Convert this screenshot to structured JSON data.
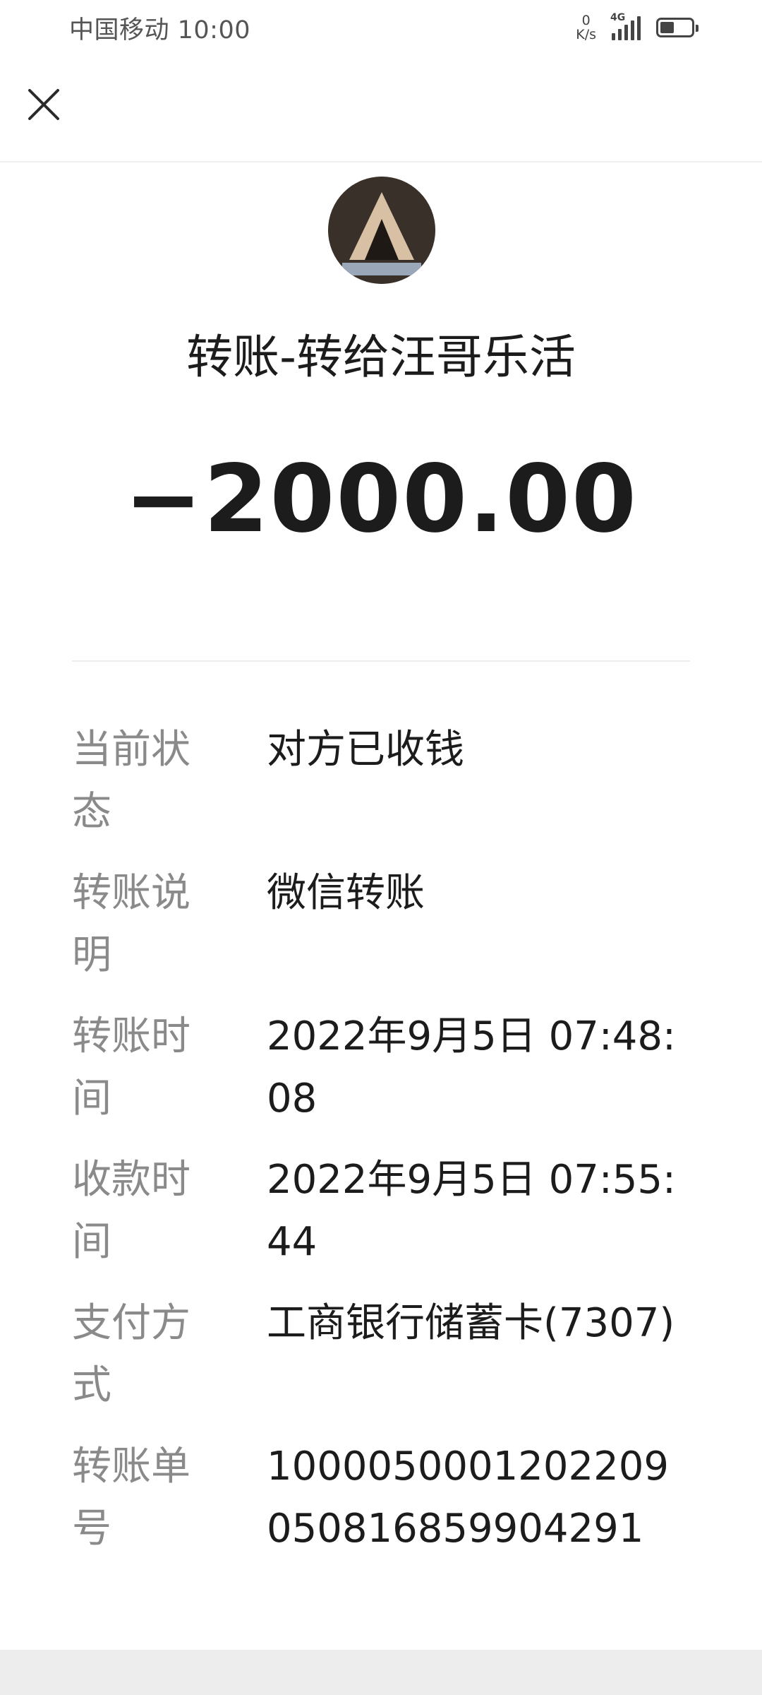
{
  "status_bar": {
    "carrier_time": "中国移动 10:00",
    "net_speed_value": "0",
    "net_speed_unit": "K/s",
    "network_type": "4G",
    "battery_level": 0.45
  },
  "header": {
    "close_icon": "close-icon"
  },
  "transfer": {
    "title": "转账-转给汪哥乐活",
    "amount": "−2000.00"
  },
  "details": [
    {
      "label": "当前状态",
      "value": "对方已收钱"
    },
    {
      "label": "转账说明",
      "value": "微信转账"
    },
    {
      "label": "转账时间",
      "value": "2022年9月5日 07:48:08"
    },
    {
      "label": "收款时间",
      "value": "2022年9月5日 07:55:44"
    },
    {
      "label": "支付方式",
      "value": "工商银行储蓄卡(7307)"
    },
    {
      "label": "转账单号",
      "value": "1000050001202209050816859904291"
    }
  ]
}
